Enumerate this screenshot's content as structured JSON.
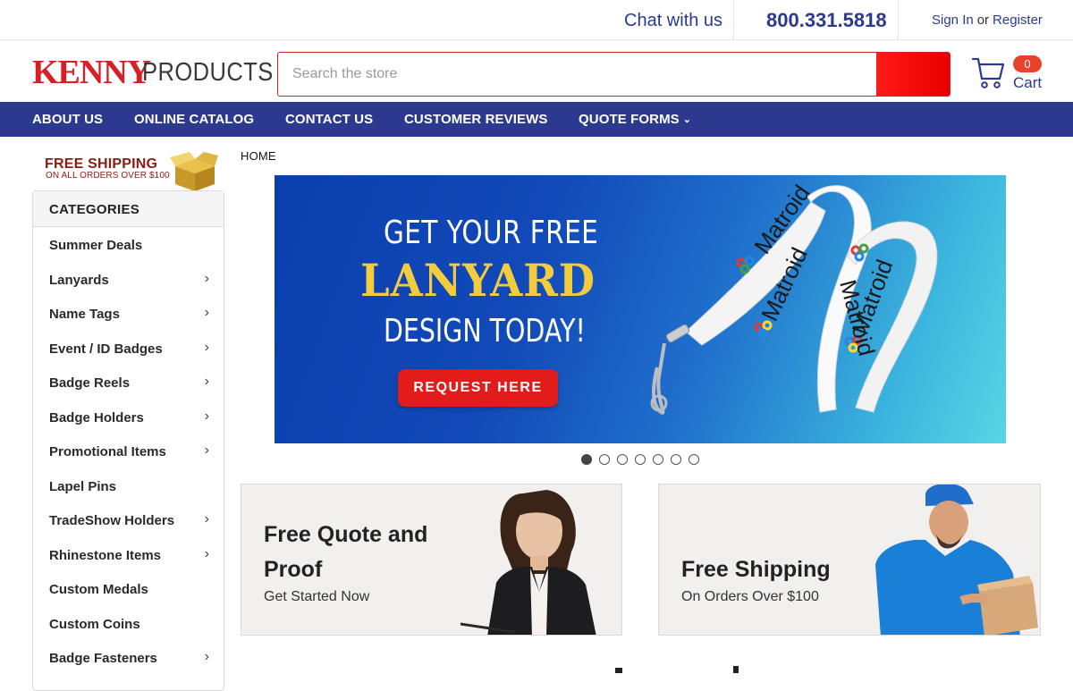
{
  "topbar": {
    "chat_label": "Chat with us",
    "phone": "800.331.5818",
    "signin_label": "Sign In",
    "or_label": "or",
    "register_label": "Register"
  },
  "header": {
    "logo_kenny": "KENNY",
    "logo_products": "PRODUCTS",
    "search_placeholder": "Search the store",
    "cart_count": "0",
    "cart_label": "Cart",
    "search_button_color": "#ff1a1a"
  },
  "nav": {
    "items": [
      "ABOUT US",
      "ONLINE CATALOG",
      "CONTACT US",
      "CUSTOMER REVIEWS",
      "QUOTE FORMS"
    ]
  },
  "sidebar": {
    "free_shipping_title": "FREE SHIPPING",
    "free_shipping_sub": "ON ALL ORDERS OVER $100",
    "categories_heading": "CATEGORIES",
    "categories": [
      {
        "label": "Summer Deals",
        "has_children": false
      },
      {
        "label": "Lanyards",
        "has_children": true
      },
      {
        "label": "Name Tags",
        "has_children": true
      },
      {
        "label": "Event / ID Badges",
        "has_children": true
      },
      {
        "label": "Badge Reels",
        "has_children": true
      },
      {
        "label": "Badge Holders",
        "has_children": true
      },
      {
        "label": "Promotional Items",
        "has_children": true
      },
      {
        "label": "Lapel Pins",
        "has_children": false
      },
      {
        "label": "TradeShow Holders",
        "has_children": true
      },
      {
        "label": "Rhinestone Items",
        "has_children": true
      },
      {
        "label": "Custom Medals",
        "has_children": false
      },
      {
        "label": "Custom Coins",
        "has_children": false
      },
      {
        "label": "Badge Fasteners",
        "has_children": true
      }
    ]
  },
  "breadcrumb": "HOME",
  "banner": {
    "line1": "GET YOUR FREE",
    "line2": "LANYARD",
    "line3": "DESIGN TODAY!",
    "cta_label": "REQUEST HERE",
    "lanyard_text": "Matroid"
  },
  "carousel": {
    "slide_count": 7,
    "active_index": 0
  },
  "promos": [
    {
      "title_line1": "Free Quote and",
      "title_line2": "Proof",
      "subtitle": "Get Started Now"
    },
    {
      "title_line1": "Free Shipping",
      "subtitle": "On Orders Over $100"
    }
  ],
  "colors": {
    "brand_blue": "#2b3a8f",
    "brand_red": "#d71f26",
    "cart_badge": "#e8412c",
    "banner_yellow": "#f3cc3e"
  }
}
